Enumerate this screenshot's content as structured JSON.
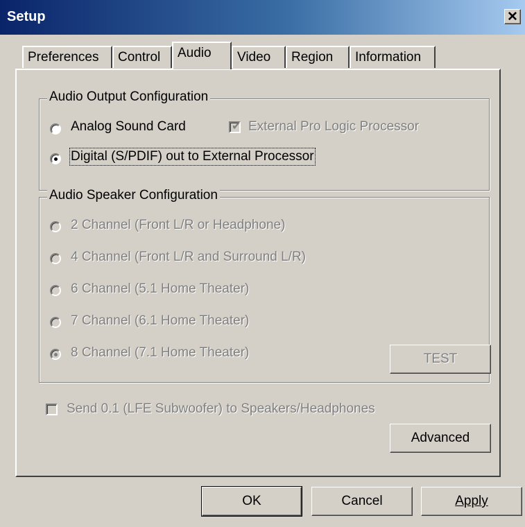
{
  "window": {
    "title": "Setup",
    "close_glyph": "✕"
  },
  "tabs": [
    {
      "label": "Preferences"
    },
    {
      "label": "Control"
    },
    {
      "label": "Audio",
      "active": true
    },
    {
      "label": "Video"
    },
    {
      "label": "Region"
    },
    {
      "label": "Information"
    }
  ],
  "audio_output": {
    "legend": "Audio Output Configuration",
    "analog_label": "Analog Sound Card",
    "analog_selected": false,
    "pro_logic_label": "External Pro Logic Processor",
    "pro_logic_checked": true,
    "pro_logic_enabled": false,
    "digital_label": "Digital (S/PDIF) out to External Processor",
    "digital_selected": true
  },
  "speaker_config": {
    "legend": "Audio Speaker Configuration",
    "options": [
      {
        "label": "2 Channel (Front L/R or Headphone)",
        "selected": false
      },
      {
        "label": "4 Channel (Front L/R and Surround L/R)",
        "selected": false
      },
      {
        "label": "6 Channel (5.1 Home Theater)",
        "selected": false
      },
      {
        "label": "7 Channel (6.1 Home Theater)",
        "selected": false
      },
      {
        "label": "8 Channel (7.1 Home Theater)",
        "selected": true
      }
    ],
    "enabled": false,
    "test_label": "TEST"
  },
  "lfe": {
    "label": "Send 0.1 (LFE Subwoofer) to Speakers/Headphones",
    "checked": false,
    "enabled": false
  },
  "buttons": {
    "advanced": "Advanced",
    "ok": "OK",
    "cancel": "Cancel",
    "apply": "Apply"
  },
  "colors": {
    "face": "#d4d0c8",
    "title_start": "#0a246a",
    "title_end": "#a6caf0",
    "disabled_text": "#808080"
  }
}
